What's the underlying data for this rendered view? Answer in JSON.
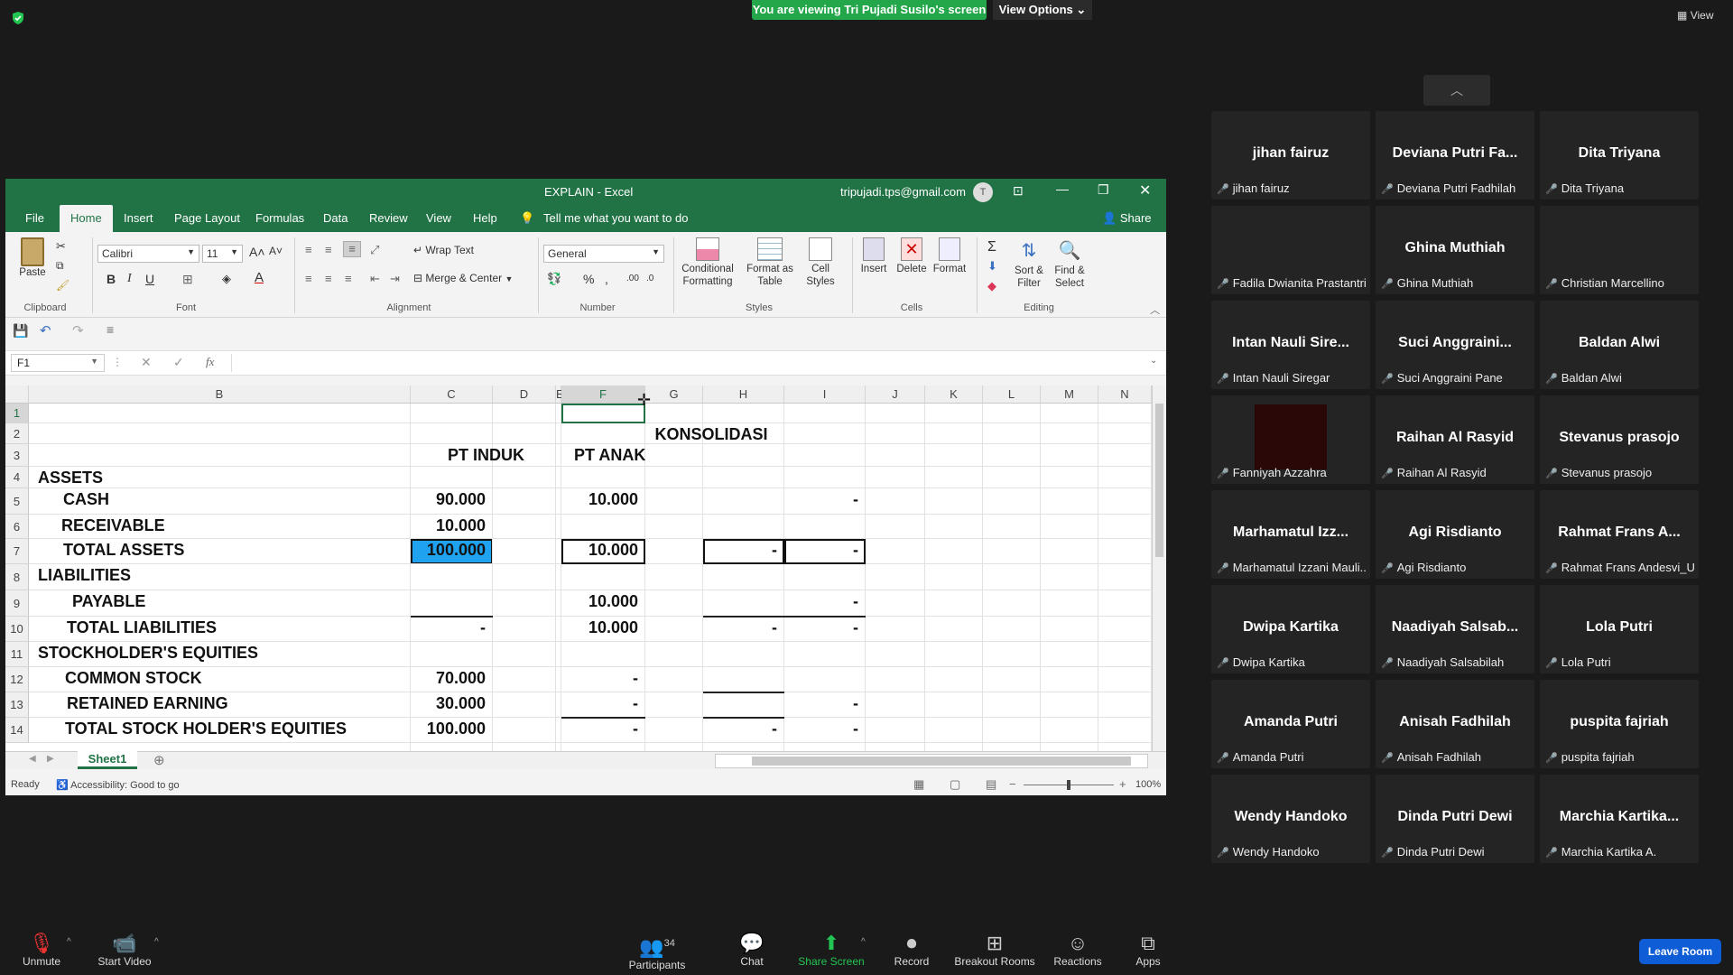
{
  "zoom": {
    "viewing_banner": "You are viewing Tri Pujadi Susilo's screen",
    "view_options": "View Options",
    "view_label": "View",
    "bottom": {
      "unmute": "Unmute",
      "start_video": "Start Video",
      "participants": "Participants",
      "participants_count": "34",
      "chat": "Chat",
      "share_screen": "Share Screen",
      "record": "Record",
      "breakout_rooms": "Breakout Rooms",
      "reactions": "Reactions",
      "apps": "Apps",
      "leave_room": "Leave Room"
    },
    "gallery": [
      {
        "name": "jihan fairuz",
        "label": "jihan fairuz"
      },
      {
        "name": "Deviana  Putri  Fa...",
        "label": "Deviana Putri Fadhilah"
      },
      {
        "name": "Dita Triyana",
        "label": "Dita Triyana"
      },
      {
        "name": "",
        "label": "Fadila Dwianita Prastantri"
      },
      {
        "name": "Ghina Muthiah",
        "label": "Ghina Muthiah"
      },
      {
        "name": "",
        "label": "Christian Marcellino"
      },
      {
        "name": "Intan  Nauli  Sire...",
        "label": "Intan Nauli Siregar"
      },
      {
        "name": "Suci  Anggraini...",
        "label": "Suci Anggraini Pane"
      },
      {
        "name": "Baldan Alwi",
        "label": "Baldan Alwi"
      },
      {
        "name": "",
        "label": "Fanniyah Azzahra"
      },
      {
        "name": "Raihan Al Rasyid",
        "label": "Raihan Al Rasyid"
      },
      {
        "name": "Stevanus prasojo",
        "label": "Stevanus prasojo"
      },
      {
        "name": "Marhamatul  Izz...",
        "label": "Marhamatul Izzani Mauli..."
      },
      {
        "name": "Agi Risdianto",
        "label": "Agi Risdianto"
      },
      {
        "name": "Rahmat Frans A...",
        "label": "Rahmat Frans Andesvi_U..."
      },
      {
        "name": "Dwipa Kartika",
        "label": "Dwipa Kartika"
      },
      {
        "name": "Naadiyah  Salsab...",
        "label": "Naadiyah Salsabilah"
      },
      {
        "name": "Lola Putri",
        "label": "Lola Putri"
      },
      {
        "name": "Amanda Putri",
        "label": "Amanda Putri"
      },
      {
        "name": "Anisah Fadhilah",
        "label": "Anisah Fadhilah"
      },
      {
        "name": "puspita fajriah",
        "label": "puspita fajriah"
      },
      {
        "name": "Wendy Handoko",
        "label": "Wendy Handoko"
      },
      {
        "name": "Dinda Putri Dewi",
        "label": "Dinda Putri Dewi"
      },
      {
        "name": "Marchia  Kartika...",
        "label": "Marchia Kartika A."
      }
    ]
  },
  "excel": {
    "title": "EXPLAIN  -  Excel",
    "email": "tripujadi.tps@gmail.com",
    "avatar": "T",
    "tabs": [
      "File",
      "Home",
      "Insert",
      "Page Layout",
      "Formulas",
      "Data",
      "Review",
      "View",
      "Help"
    ],
    "tell_me": "Tell me what you want to do",
    "share": "Share",
    "ribbon": {
      "paste": "Paste",
      "clipboard": "Clipboard",
      "font_name": "Calibri",
      "font_size": "11",
      "font": "Font",
      "wrap_text": "Wrap Text",
      "merge_center": "Merge & Center",
      "alignment": "Alignment",
      "number_format": "General",
      "number": "Number",
      "cond_fmt_1": "Conditional",
      "cond_fmt_2": "Formatting",
      "fmt_table_1": "Format as",
      "fmt_table_2": "Table",
      "cell_styles_1": "Cell",
      "cell_styles_2": "Styles",
      "styles": "Styles",
      "insert": "Insert",
      "delete": "Delete",
      "format": "Format",
      "cells": "Cells",
      "sort_1": "Sort &",
      "sort_2": "Filter",
      "find_1": "Find &",
      "find_2": "Select",
      "editing": "Editing"
    },
    "name_box": "F1",
    "columns": [
      "B",
      "C",
      "D",
      "E",
      "F",
      "G",
      "H",
      "I",
      "J",
      "K",
      "L",
      "M",
      "N"
    ],
    "rows": [
      "1",
      "2",
      "3",
      "4",
      "5",
      "6",
      "7",
      "8",
      "9",
      "10",
      "11",
      "12",
      "13",
      "14"
    ],
    "cells": {
      "konsolidasi": "KONSOLIDASI",
      "pt_induk": "PT INDUK",
      "pt_anak": "PT ANAK",
      "assets": "ASSETS",
      "cash": "CASH",
      "receivable": "RECEIVABLE",
      "total_assets": "TOTAL ASSETS",
      "liabilities": "LIABILITIES",
      "payable": "PAYABLE",
      "total_liabilities": "TOTAL LIABILITIES",
      "equities": "STOCKHOLDER'S EQUITIES",
      "common_stock": "COMMON STOCK",
      "retained": "RETAINED EARNING",
      "total_equities": "TOTAL STOCK HOLDER'S EQUITIES",
      "c5": "90.000",
      "c6": "10.000",
      "c7": "100.000",
      "c10": "-",
      "c12": "70.000",
      "c13": "30.000",
      "c14": "100.000",
      "f5": "10.000",
      "f7": "10.000",
      "f9": "10.000",
      "f10": "10.000",
      "f12": "-",
      "f13": "-",
      "f14": "-",
      "h7": "-",
      "h10": "-",
      "h14": "-",
      "i5": "-",
      "i7": "-",
      "i9": "-",
      "i10": "-",
      "i13": "-",
      "i14": "-"
    },
    "sheet_tab": "Sheet1",
    "status_ready": "Ready",
    "accessibility": "Accessibility: Good to go",
    "zoom": "100%"
  }
}
